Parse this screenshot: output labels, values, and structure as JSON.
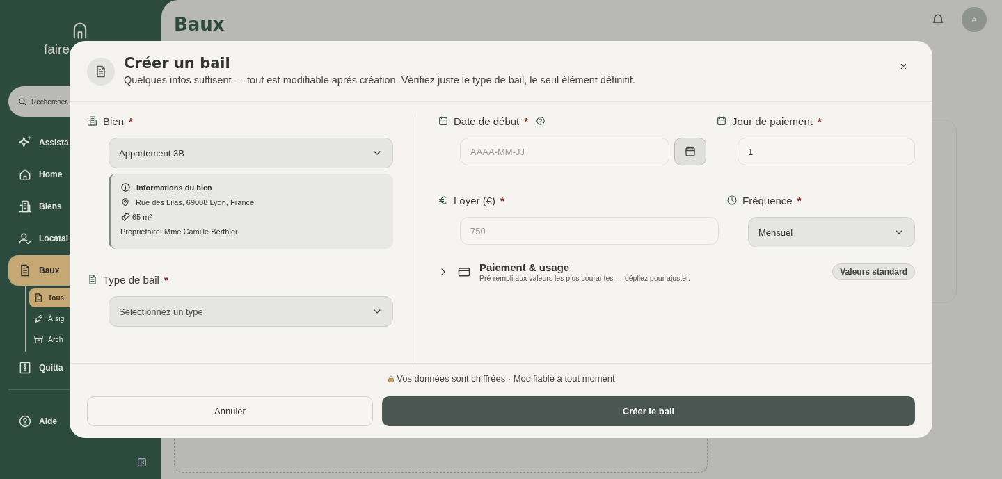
{
  "sidebar": {
    "logo": "faire",
    "search": {
      "placeholder": "Rechercher."
    },
    "items": [
      {
        "label": "Assista",
        "selected": false
      },
      {
        "label": "Home",
        "selected": false
      },
      {
        "label": "Biens",
        "selected": false
      },
      {
        "label": "Locatai",
        "selected": false
      },
      {
        "label": "Baux",
        "selected": true,
        "children": [
          {
            "label": "Tous",
            "selected": true
          },
          {
            "label": "À sig",
            "selected": false
          },
          {
            "label": "Arch",
            "selected": false
          }
        ]
      },
      {
        "label": "Quitta",
        "selected": false
      }
    ],
    "footer_items": [
      {
        "label": "Aide",
        "selected": false
      }
    ]
  },
  "header": {
    "title": "Baux",
    "avatar": "A"
  },
  "modal": {
    "title": "Créer un bail",
    "subtitle": "Quelques infos suffisent — tout est modifiable après création. Vérifiez juste le type de bail, le seul élément définitif.",
    "property": {
      "label": "Bien",
      "mark": "*",
      "value": "Appartement 3B",
      "info": {
        "title": "Informations du bien",
        "address": "Rue des Lilas, 69008 Lyon, France",
        "area": "65 m²",
        "owner": "Propriétaire: Mme Camille Berthier"
      }
    },
    "lease_type": {
      "label": "Type de bail",
      "mark": "*",
      "placeholder": "Sélectionnez un type"
    },
    "start_date": {
      "label": "Date de début",
      "mark": "*",
      "placeholder": "AAAA-MM-JJ"
    },
    "payment_day": {
      "label": "Jour de paiement",
      "mark": "*",
      "value": "1"
    },
    "rent": {
      "label": "Loyer (€)",
      "mark": "*",
      "placeholder": "750"
    },
    "frequency": {
      "label": "Fréquence",
      "mark": "*",
      "value": "Mensuel"
    },
    "section": {
      "title": "Paiement & usage",
      "subtitle": "Pré-rempli aux valeurs les plus courantes — dépliez pour ajuster.",
      "badge": "Valeurs standard",
      "expanded": false
    },
    "note": "Vos données sont chiffrées · Modifiable à tout moment",
    "buttons": [
      {
        "label": "Annuler",
        "kind": "secondary"
      },
      {
        "label": "Créer le bail",
        "kind": "primary"
      }
    ]
  }
}
